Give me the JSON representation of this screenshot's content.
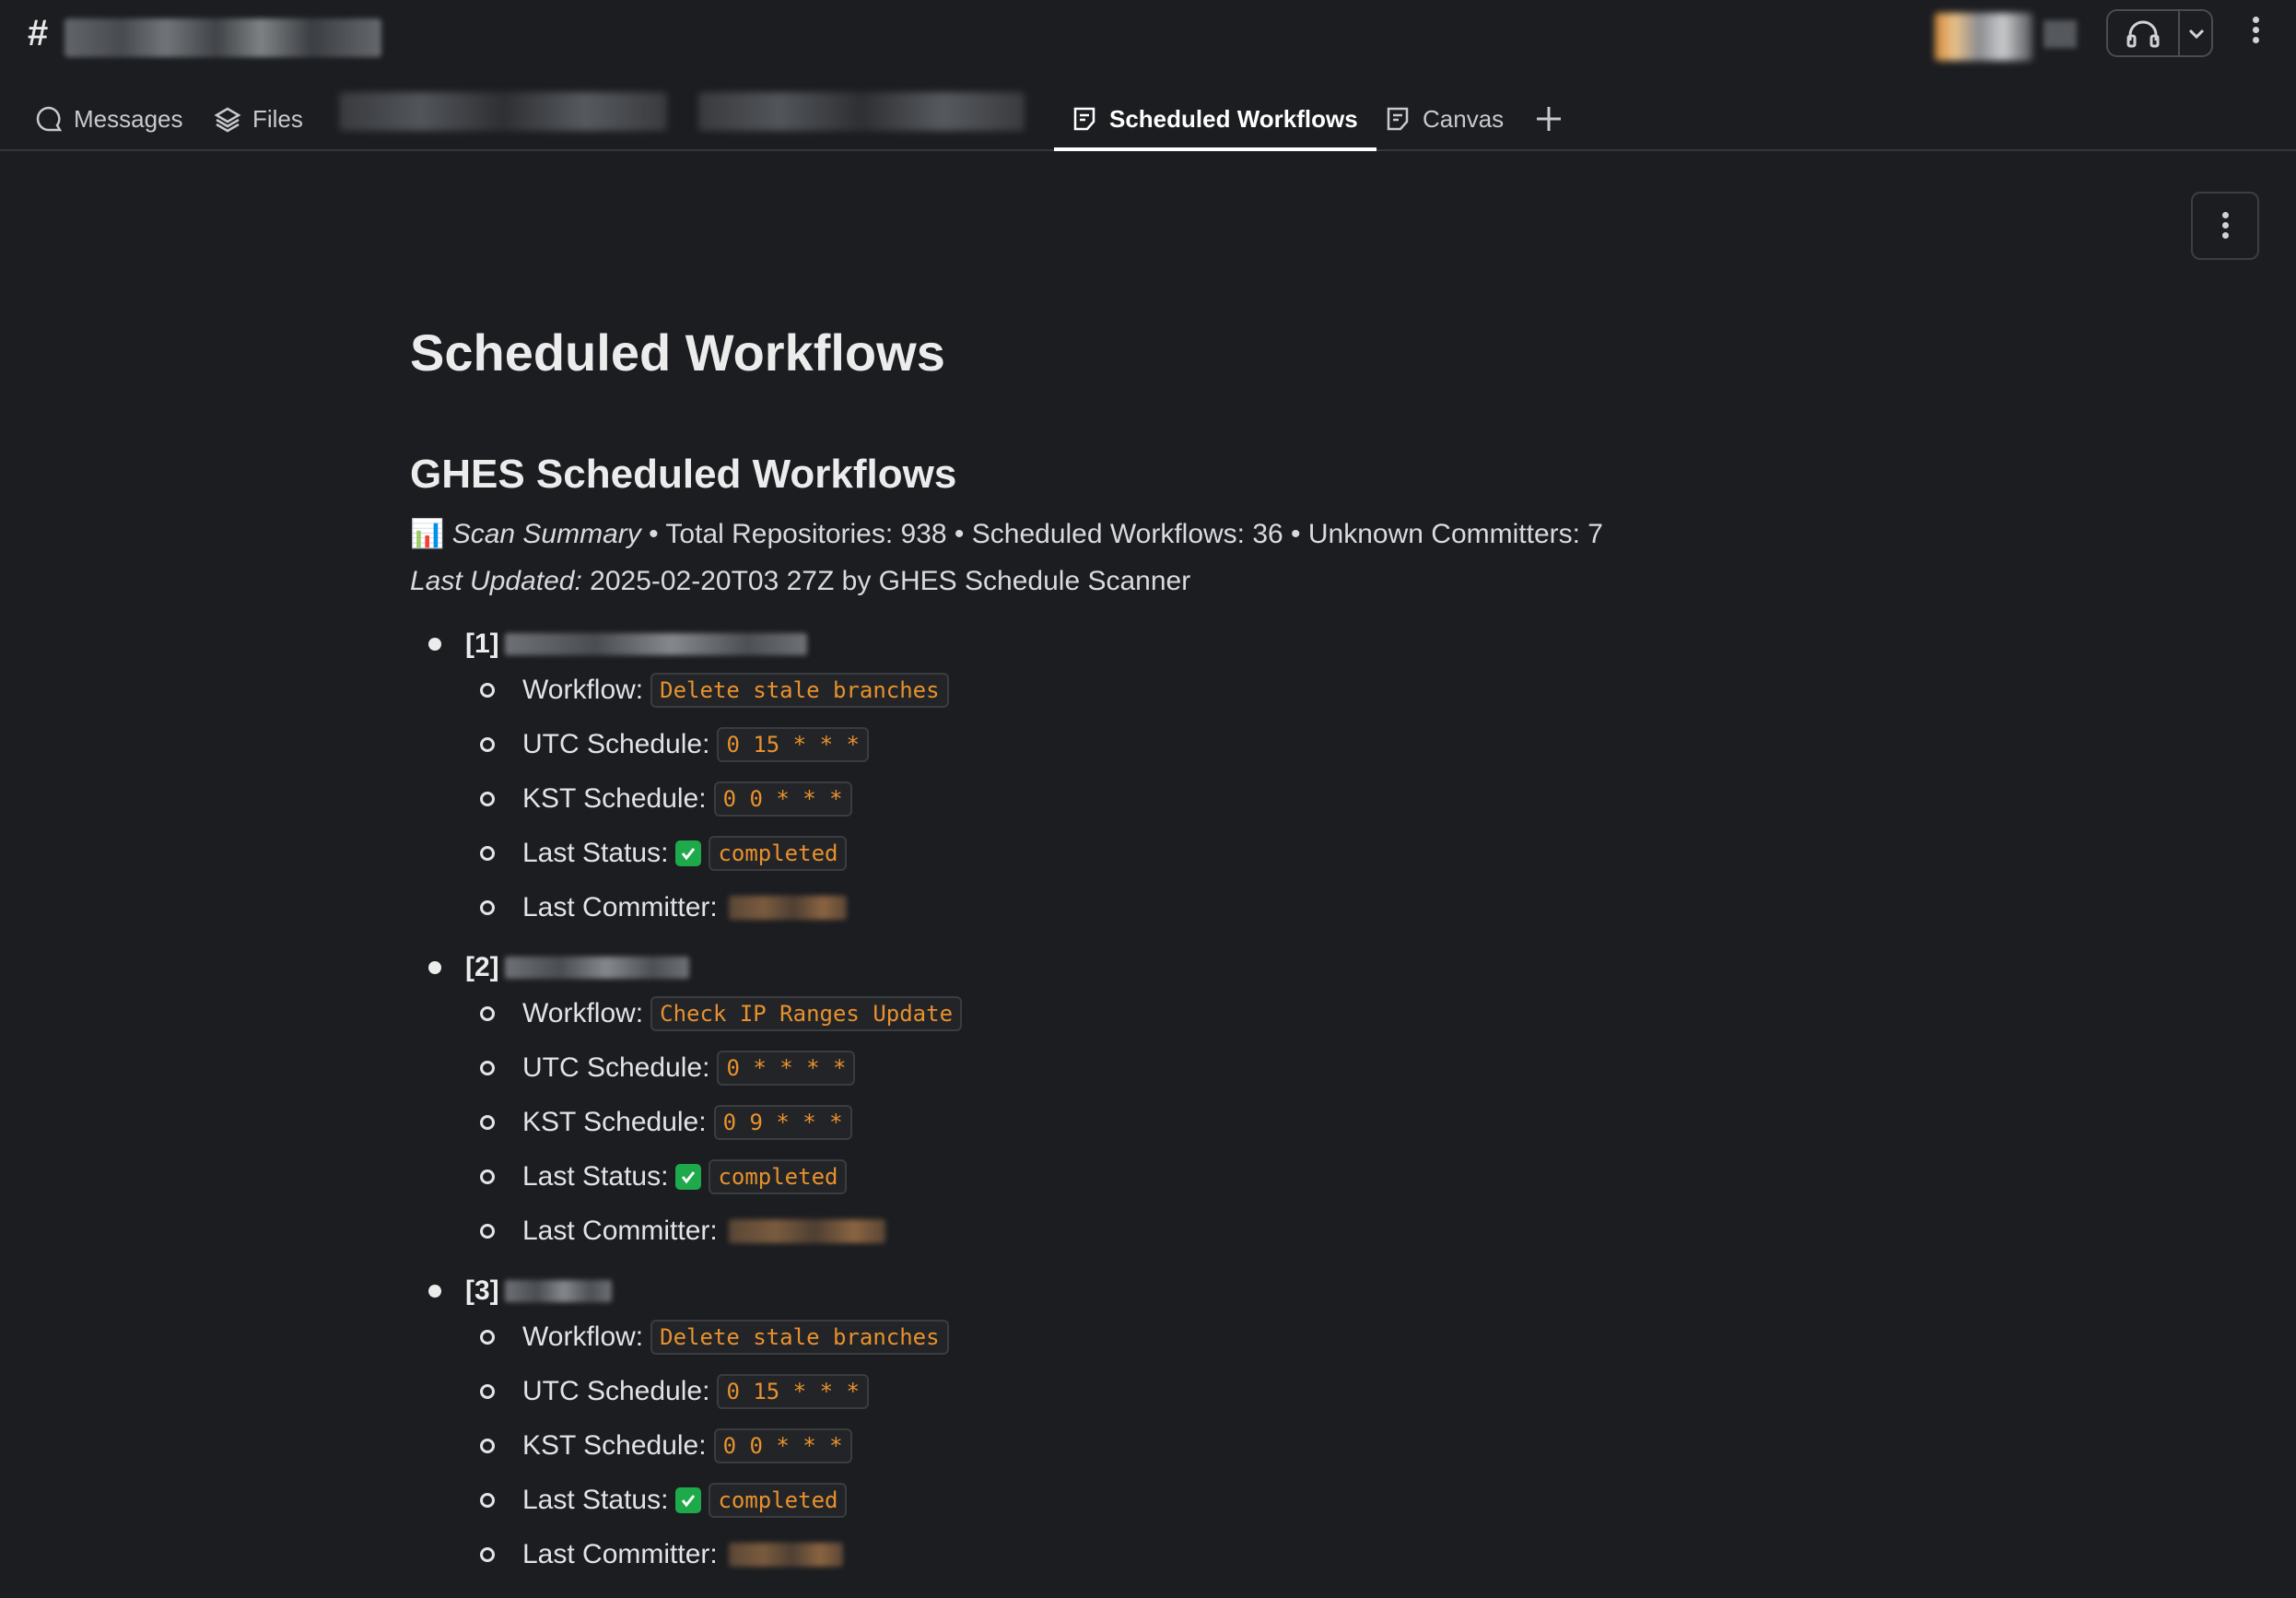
{
  "header": {
    "channel_prefix": "#"
  },
  "tabs": [
    {
      "label": "Messages",
      "icon": "message-bubble-icon",
      "active": false
    },
    {
      "label": "Files",
      "icon": "layers-icon",
      "active": false
    },
    {
      "label": "Scheduled Workflows",
      "icon": "canvas-doc-icon",
      "active": true
    },
    {
      "label": "Canvas",
      "icon": "canvas-doc-icon",
      "active": false
    }
  ],
  "page": {
    "title": "Scheduled Workflows",
    "section_title": "GHES Scheduled Workflows",
    "summary": {
      "emoji": "📊",
      "label": "Scan Summary",
      "stats": "• Total Repositories: 938 • Scheduled Workflows: 36 • Unknown Committers: 7"
    },
    "updated": {
      "label": "Last Updated:",
      "value": "2025-02-20T03 27Z by GHES Schedule Scanner"
    }
  },
  "field_labels": {
    "workflow": "Workflow:",
    "utc": "UTC Schedule:",
    "kst": "KST Schedule:",
    "status": "Last Status:",
    "committer": "Last Committer:"
  },
  "repos": [
    {
      "index": "[1]",
      "workflow": "Delete stale branches",
      "utc": "0 15 * * *",
      "kst": "0 0 * * *",
      "status": "completed"
    },
    {
      "index": "[2]",
      "workflow": "Check IP Ranges Update",
      "utc": "0 * * * *",
      "kst": "0 9 * * *",
      "status": "completed"
    },
    {
      "index": "[3]",
      "workflow": "Delete stale branches",
      "utc": "0 15 * * *",
      "kst": "0 0 * * *",
      "status": "completed"
    }
  ],
  "colors": {
    "background": "#1b1d21",
    "code_text": "#e8912d",
    "status_check": "#1ea94a"
  }
}
